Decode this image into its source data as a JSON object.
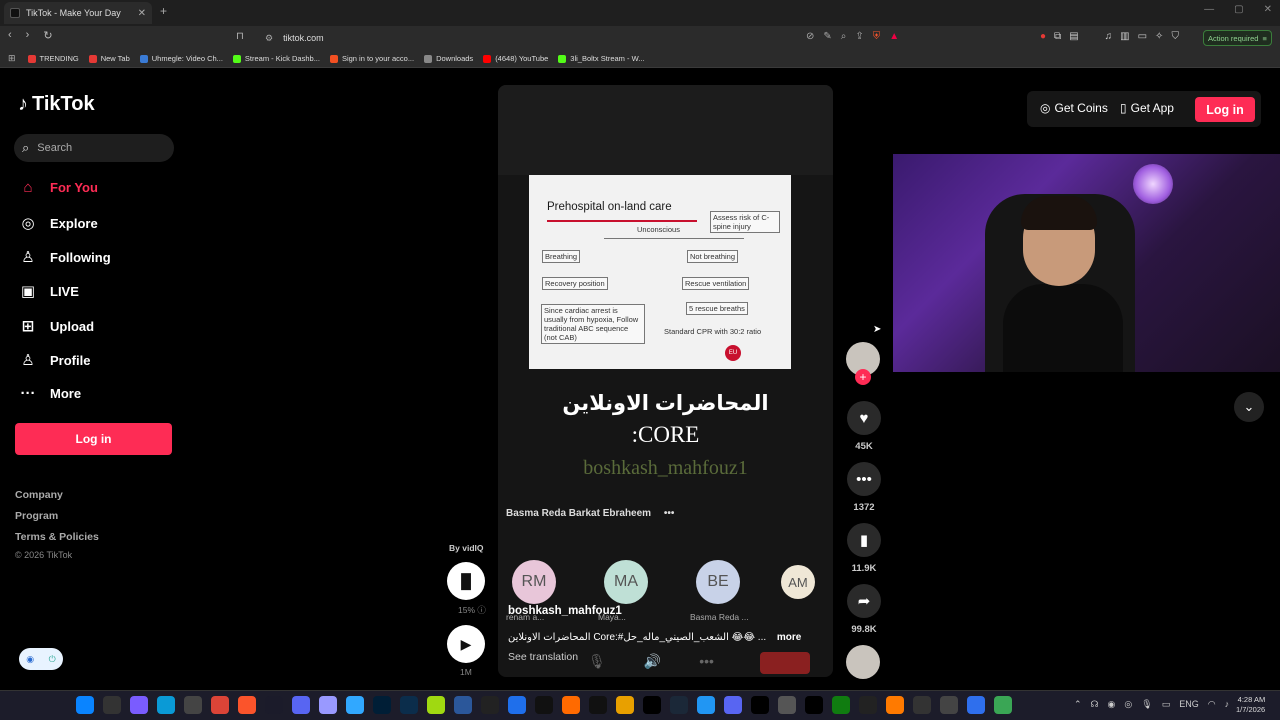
{
  "browser": {
    "tab_title": "TikTok - Make Your Day",
    "tab_close": "✕",
    "new_tab": "+",
    "url": "tiktok.com",
    "action_required": "Action required",
    "bookmarks": [
      {
        "label": "TRENDING",
        "color": "#e53935"
      },
      {
        "label": "New Tab",
        "color": "#e53935"
      },
      {
        "label": "Uhmegle: Video Ch...",
        "color": "#3a7bd5"
      },
      {
        "label": "Stream - Kick Dashb...",
        "color": "#53fc18"
      },
      {
        "label": "Sign in to your acco...",
        "color": "#f25022"
      },
      {
        "label": "Downloads",
        "color": "#888888"
      },
      {
        "label": "(4648) YouTube",
        "color": "#ff0000"
      },
      {
        "label": "3li_Boltx Stream - W...",
        "color": "#53fc18"
      }
    ]
  },
  "tiktok": {
    "logo": "TikTok",
    "search_placeholder": "Search",
    "nav": [
      {
        "label": "For You",
        "icon": "home-icon",
        "glyph": "⌂"
      },
      {
        "label": "Explore",
        "icon": "compass-icon",
        "glyph": "◎"
      },
      {
        "label": "Following",
        "icon": "user-plus-icon",
        "glyph": "♙"
      },
      {
        "label": "LIVE",
        "icon": "live-icon",
        "glyph": "▣"
      },
      {
        "label": "Upload",
        "icon": "upload-icon",
        "glyph": "⊞"
      },
      {
        "label": "Profile",
        "icon": "profile-icon",
        "glyph": "♙"
      },
      {
        "label": "More",
        "icon": "more-icon",
        "glyph": "···"
      }
    ],
    "login": "Log in",
    "footer": [
      "Company",
      "Program",
      "Terms & Policies"
    ],
    "copyright": "© 2026 TikTok",
    "top_right": {
      "coins": "Get Coins",
      "app": "Get App",
      "login": "Log in"
    }
  },
  "video": {
    "slide_title": "Prehospital on-land care",
    "slide_boxes": {
      "unconscious": "Unconscious",
      "spine": "Assess risk of C-spine injury",
      "breathing": "Breathing",
      "not_breathing": "Not breathing",
      "recovery": "Recovery position",
      "rescue_vent": "Rescue ventilation",
      "rescue_breaths": "5 rescue breaths",
      "cardiac": "Since cardiac arrest is usually from hypoxia, Follow traditional ABC sequence (not CAB)",
      "cpr": "Standard CPR with 30:2 ratio"
    },
    "caption_ar": "المحاضرات الاونلاين",
    "caption_core": ":CORE",
    "caption_user": "boshkash_mahfouz1",
    "live_host": "Basma Reda Barkat Ebraheem",
    "live_dots": "•••",
    "avatars": [
      {
        "initials": "RM",
        "color": "#e8c6d9",
        "name": "renam a..."
      },
      {
        "initials": "MA",
        "color": "#bfe0d6",
        "name": "Maya..."
      },
      {
        "initials": "BE",
        "color": "#c8d2e8",
        "name": "Basma Reda ..."
      },
      {
        "initials": "AM",
        "color": "#efe7d6",
        "name": ""
      }
    ],
    "author": "boshkash_mahfouz1",
    "description": "المحاضرات الاونلاين Core:#الشعب_الصيني_ماله_حل 😂😂 ...",
    "more": "more",
    "see_translation": "See translation"
  },
  "vidiq": {
    "by": "By vidIQ",
    "pct": "15%",
    "count": "1M"
  },
  "actions": {
    "likes": "45K",
    "comments": "1372",
    "saves": "11.9K",
    "shares": "99.8K"
  },
  "taskbar": {
    "time": "4:28 AM",
    "date": "1/7/2026",
    "lang": "ENG"
  }
}
